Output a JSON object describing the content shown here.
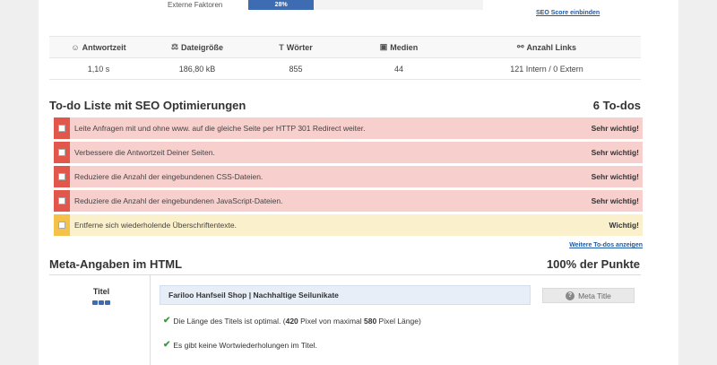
{
  "external": {
    "label": "Externe Faktoren",
    "percent_text": "28%",
    "percent": 0.28
  },
  "seo_score_link": "SEO Score einbinden",
  "stats": {
    "headers": [
      {
        "icon": "☺",
        "label": "Antwortzeit"
      },
      {
        "icon": "⚖",
        "label": "Dateigröße"
      },
      {
        "icon": "T",
        "label": "Wörter"
      },
      {
        "icon": "▣",
        "label": "Medien"
      },
      {
        "icon": "⚯",
        "label": "Anzahl Links"
      }
    ],
    "values": [
      "1,10 s",
      "186,80 kB",
      "855",
      "44",
      "121 Intern / 0 Extern"
    ]
  },
  "todo": {
    "title": "To-do Liste mit SEO Optimierungen",
    "count": "6 To-dos",
    "items": [
      {
        "text": "Leite Anfragen mit und ohne www. auf die gleiche Seite per HTTP 301 Redirect weiter.",
        "priority": "Sehr wichtig!",
        "level": "red"
      },
      {
        "text": "Verbessere die Antwortzeit Deiner Seiten.",
        "priority": "Sehr wichtig!",
        "level": "red"
      },
      {
        "text": "Reduziere die Anzahl der eingebundenen CSS-Dateien.",
        "priority": "Sehr wichtig!",
        "level": "red"
      },
      {
        "text": "Reduziere die Anzahl der eingebundenen JavaScript-Dateien.",
        "priority": "Sehr wichtig!",
        "level": "red"
      },
      {
        "text": "Entferne sich wiederholende Überschriftentexte.",
        "priority": "Wichtig!",
        "level": "yellow"
      }
    ],
    "more_link": "Weitere To-dos anzeigen"
  },
  "meta": {
    "title": "Meta-Angaben im HTML",
    "score": "100% der Punkte",
    "label": "Titel",
    "page_title": "Fariloo Hanfseil Shop | Nachhaltige Seilunikate",
    "check1_pre": "Die Länge des Titels ist optimal. (",
    "check1_px": "420",
    "check1_mid": " Pixel von maximal ",
    "check1_max": "580",
    "check1_post": " Pixel Länge)",
    "check2": "Es gibt keine Wortwiederholungen im Titel.",
    "button": "Meta Title"
  },
  "colors": {
    "accent": "#3d6cb3",
    "danger": "#e2574c",
    "warning": "#f4c24a",
    "link": "#1e5aa7",
    "ok": "#3c9a3c"
  }
}
